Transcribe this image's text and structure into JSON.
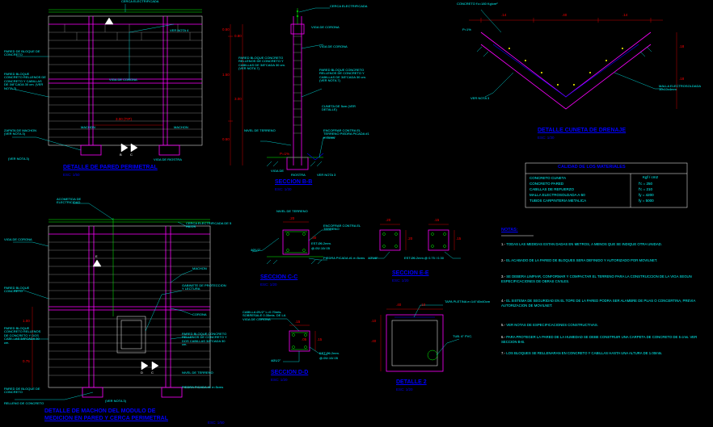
{
  "title_perimetral": "DETALLE DE PARED PERIMETRAL",
  "title_perimetral_esc": "ESC: 1/50",
  "title_machon": "DETALLE DE MACHON DEL MODULO DE",
  "title_machon2": "MEDICION EN PARED Y CERCA PERIMETRAL",
  "title_machon_esc": "ESC: 1/50",
  "title_bb": "SECCION B-B",
  "title_bb_esc": "ESC: 1/30",
  "title_cc": "SECCION C-C",
  "title_cc_esc": "ESC: 1/20",
  "title_dd": "SECCION D-D",
  "title_dd_esc": "ESC: 1/20",
  "title_ee": "SECCION E-E",
  "title_ee_esc": "ESC: 1/20",
  "title_det2": "DETALLE 2",
  "title_det2_esc": "ESC: 1/20",
  "title_cuneta": "DETALLE CUNETA DE DRENAJE",
  "title_cuneta_esc": "ESC: 1/30",
  "materials_header": "CALIDAD DE LOS MATERIALES",
  "materials_unit": "Kgf / cm2",
  "mat1": "CONCRETO CUNETA",
  "mat1v": "f'c = 250",
  "mat2": "CONCRETO PARED",
  "mat2v": "f'c = 210",
  "mat3": "CABILLAS DE REFUERZO",
  "mat3v": "fy = 4200",
  "mat4": "MALLA ELECTROSOLDADA A-50",
  "mat4v": "fy = 5000",
  "mat5": "TUBOS CARPINTERIA METALICA",
  "notas_header": "NOTAS:",
  "nota1": "TODAS LAS MEDIDAS ESTAN DADAS EN METROS, A MENOS QUE SE INDIQUE OTRA UNIDAD.",
  "nota2": "EL ACABADO DE LA PARED DE BLOQUES SERA DEFINIDO Y AUTORIZADO POR MOVILNET.",
  "nota3": "SE DEBERA LIMPIAR, CONFORMAR Y COMPACTAR EL TERRENO PARA LA CONSTRUCCION DE LA VIGA SEGUN ESPECIFICACIONES DE OBRAS CIVILES.",
  "nota4": "EL SISTEMA DE SEGURIDAD EN EL TOPE DE LA PARED PODRA SER ALAMBRE DE PUAS O CONCERTINA, PREVIA AUTORIZACION DE MOVILNET.",
  "nota5": "VER NOTAS DE ESPECIFICACIONES CONSTRUCTIVAS.",
  "nota6": "PARA PROTEGER LA PARED DE LA HUMEDAD SE DEBE CONSTRUIR UNA CARPETA DE CONCRETO DE 5 cms. VER SECCION B-B.",
  "nota7": "LOS BLOQUES SE RELLENARAN EN CONCRETO Y CABILLAS HASTA UNA ALTURA DE 1.00mts.",
  "lbl_cerca": "CERCA ELECTRIFICADA",
  "lbl_vernota4": "VER NOTA 4",
  "lbl_pared_bloque": "PARED DE BLOQUE DE CONCRETO",
  "lbl_pared_desc": "PARED BLOQUE CONCRETO RELLENOS DE CONCRETO Y CABILLAS DE 3/8\"CADA 30 cm. (VER NOTA 7)",
  "lbl_zapata": "ZAPATA DE MACHON (VER NOTA 3)",
  "lbl_machon": "MACHON",
  "lbl_viga_corona": "VIGA DE CORONA",
  "lbl_dim300": "3.00 (TIP)",
  "lbl_vernota3": "(VER NOTA 3)",
  "lbl_viga_riostra": "VIGA DE RIOSTRA",
  "lbl_acometida": "ACOMETIDA DE ELECTRICIDAD",
  "lbl_cerca5h": "CERCA ELECTRIFICADA DE 5 HILOS",
  "lbl_viga_corona2": "VIGA DE CORONA",
  "lbl_gabinete": "GABINETE DE PROTECCION Y LECTURA",
  "lbl_machon2": "MACHON",
  "lbl_corona2": "CORONA",
  "lbl_pared_bloque2": "PARED BLOQUE CONCRETO",
  "lbl_pared_desc2": "PARED BLOQUE CONCRETO RELLENOS DE CONCRETO Y DOS CABILLAS 3/8\"CADA 30 cm.",
  "lbl_relleno": "RELLENO DE CONCRETO",
  "lbl_nivel_terreno": "NIVEL DE TERRENO",
  "lbl_piedra": "PIEDRA PICADA #1 e=5cms",
  "lbl_vernota3b": "(VER NOTA 3)",
  "lbl_cerca_elect": "CERCA ELECTRIFICADA",
  "lbl_viga_corona3": "VIGA DE CORONA",
  "lbl_viga_corona4": "VIGA DE CORONA",
  "lbl_pared_desc3": "PARED BLOQUE CONCRETO RELLENOS DE CONCRETO Y CABILLAS DE 3/8\"CADA 30 cm. (VER NOTA 7)",
  "lbl_cuneta": "CUNETA DE 5cm (VER DETALLE)",
  "lbl_encofrar": "ENCOFRAR CONTRA EL TERRENO PIEDRA PICADA #1 e=5cms",
  "lbl_viga_de": "VIGA DE",
  "lbl_riostra2": "RIOSTRA",
  "lbl_vernota3c": "VER NOTA 3",
  "lbl_nivel_terr2": "NIVEL DE TERRENO",
  "lbl_nivel_terr3": "NIVEL DE TERRENO",
  "lbl_est2": "EST.Ø6.2mm.",
  "lbl_est2b": "@.05/.10/.05",
  "lbl_encofrar2": "ENCOFRAR CONTRA EL TERRENO",
  "lbl_piedra2": "PIEDRA PICADA #1 e=5cms",
  "lbl_cabilla": "CABILLA Ø1/2\" L=0.70mts. SOBRESALE 0.35mts. DE LA VIGA DE CORONA",
  "lbl_4phi": "4Ø1/2\"",
  "lbl_4phi2": "4Ø1/2\"",
  "lbl_est3": "EST.Ø6.2mm.",
  "lbl_est3b": "@.05/.10/.05",
  "lbl_tapa": "TAPA PLETINA e=1/4\"40x40cm",
  "lbl_tub": "TUB. 6\" PVC.",
  "lbl_4phi3": "4Ø5/8\"",
  "lbl_est4": "EST.Ø6.2mm.@ 0.75 / 0.30",
  "lbl_concreto_cun": "CONCRETO f'c=180 Kg/cm²",
  "lbl_p15": "P=1%",
  "lbl_malla": "MALLA ELECTROSOLDADA 10x10x4mm",
  "lbl_vernota3d": "VER NOTA 3",
  "dim_050": "0.50",
  "dim_150": "1.50",
  "dim_050b": "0.50",
  "dim_080": "0.80",
  "dim_300": "3.00",
  "dim_100": "1.00",
  "dim_075": "0.75",
  "dim_15": ".15",
  "dim_30": ".30",
  "dim_20": ".20",
  "dim_20b": ".20",
  "dim_40": ".40",
  "dim_40b": ".40",
  "dim_05": ".05",
  "dim_14": ".14",
  "dim_14b": ".14",
  "dim_40c": ".40",
  "dim_10": ".10",
  "dim_10b": ".10",
  "dim_18": ".18",
  "dim_18b": ".18",
  "dim_15b": ".15",
  "dim_15c": ".15",
  "dim_15d": ".15",
  "dim_30b": ".30",
  "dim_p15": "P=1%",
  "sec_b": "B",
  "sec_c": "C",
  "sec_d": "D",
  "sec_e": "E"
}
